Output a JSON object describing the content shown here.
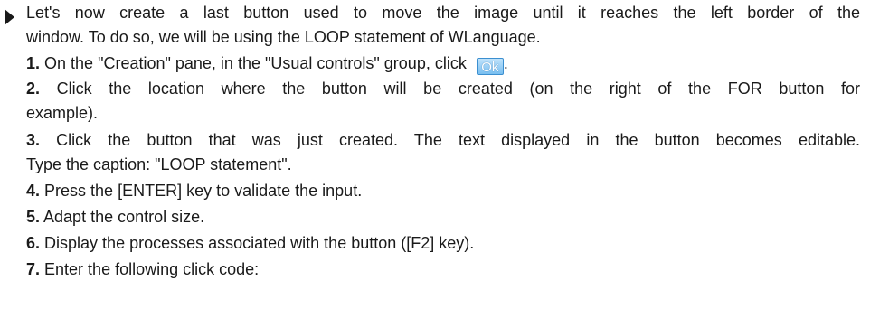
{
  "intro": {
    "line1": "Let's now create a last button used to move the image until it reaches the left border of the",
    "line2": "window. To do so, we will be using the LOOP statement of WLanguage."
  },
  "steps": [
    {
      "num": "1.",
      "text": "On the \"Creation\" pane, in the \"Usual controls\" group, click",
      "button_label": "Ok",
      "after": "."
    },
    {
      "num": "2.",
      "text_a": "Click the location where the button will be created (on the right of the FOR button for",
      "text_b": "example)."
    },
    {
      "num": "3.",
      "text_a": "Click the button that was just created. The text displayed in the button becomes editable.",
      "text_b": "Type the caption: \"LOOP statement\"."
    },
    {
      "num": "4.",
      "text": "Press the [ENTER] key to validate the input."
    },
    {
      "num": "5.",
      "text": "Adapt the control size."
    },
    {
      "num": "6.",
      "text": "Display the processes associated with the button ([F2] key)."
    },
    {
      "num": "7.",
      "text": "Enter the following click code:"
    }
  ],
  "icons": {
    "bullet": "right-triangle-bullet-icon",
    "ok_button": "ok-button-icon"
  },
  "colors": {
    "text": "#1a1a1a",
    "ok_button_fill": "#79bff0",
    "ok_button_border": "#3b8fd0"
  }
}
